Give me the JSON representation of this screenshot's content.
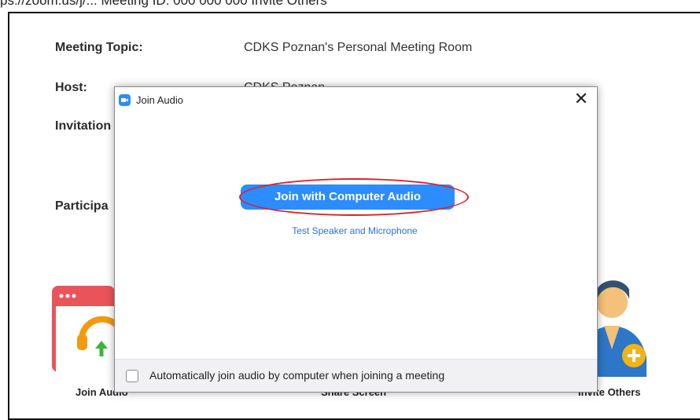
{
  "page_header_text": "ps://zoom.us/j/... Meeting ID: 000 000 000 Invite Others",
  "meeting_info": {
    "topic_label": "Meeting Topic:",
    "topic_value": "CDKS Poznan's Personal Meeting Room",
    "host_label": "Host:",
    "host_value": "CDKS Poznan",
    "invitation_label": "Invitation",
    "participant_label": "Participa"
  },
  "bottom_actions": {
    "join_audio_label": "Join Audio",
    "share_screen_label": "Share Screen",
    "invite_others_label": "Invite Others"
  },
  "dialog": {
    "title": "Join Audio",
    "close_glyph": "✕",
    "join_computer_audio_label": "Join with Computer Audio",
    "test_link_label": "Test Speaker and Microphone",
    "auto_join_label": "Automatically join audio by computer when joining a meeting",
    "auto_join_checked": false
  },
  "colors": {
    "accent_blue": "#2d8cff",
    "highlight_red": "#d9222a",
    "join_audio_icon_red": "#e8545a",
    "headphone_orange": "#f29a10",
    "arrow_green": "#3fb241"
  },
  "icons": {
    "dialog_logo": "zoom-logo-icon",
    "join_audio": "headphones-icon",
    "invite_others": "add-person-icon"
  }
}
